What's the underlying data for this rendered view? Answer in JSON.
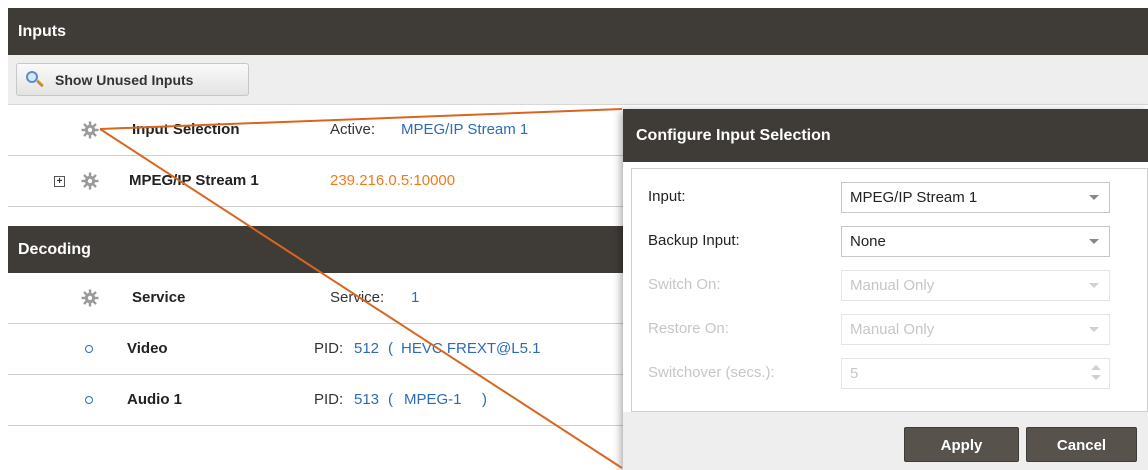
{
  "inputs": {
    "title": "Inputs",
    "show_unused_label": "Show Unused Inputs",
    "rows": [
      {
        "name": "Input Selection",
        "key": "Active:",
        "value": "MPEG/IP Stream 1"
      },
      {
        "name": "MPEG/IP Stream 1",
        "key": "",
        "value": "239.216.0.5:10000"
      }
    ]
  },
  "decoding": {
    "title": "Decoding",
    "rows": [
      {
        "name": "Service",
        "key": "Service:",
        "value": "1"
      },
      {
        "name": "Video",
        "key": "PID:",
        "value": "512",
        "detail_open": "(",
        "detail": "HEVC  FREXT@L5.1",
        "detail_close": ""
      },
      {
        "name": "Audio 1",
        "key": "PID:",
        "value": "513",
        "detail_open": "(",
        "detail": "MPEG-1",
        "detail_close": ")"
      }
    ]
  },
  "dialog": {
    "title": "Configure Input Selection",
    "fields": [
      {
        "label": "Input:",
        "value": "MPEG/IP Stream 1",
        "enabled": true
      },
      {
        "label": "Backup Input:",
        "value": "None",
        "enabled": true
      },
      {
        "label": "Switch On:",
        "value": "Manual Only",
        "enabled": false
      },
      {
        "label": "Restore On:",
        "value": "Manual Only",
        "enabled": false
      },
      {
        "label": "Switchover (secs.):",
        "value": "5",
        "enabled": false
      }
    ],
    "apply_label": "Apply",
    "cancel_label": "Cancel"
  },
  "colors": {
    "header_bg": "#3f3b37",
    "link": "#2d6cb4",
    "address": "#f07b1e",
    "connector": "#d9661f"
  },
  "icons": [
    "magnifier-icon",
    "gear-icon",
    "expand-plus-icon",
    "bullet-icon",
    "chevron-down-icon",
    "spinner-icon"
  ]
}
